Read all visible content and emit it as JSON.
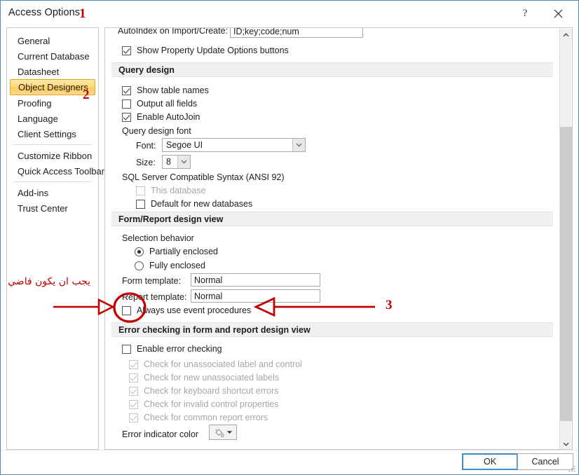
{
  "window": {
    "title": "Access Options",
    "help_icon": "?",
    "close_icon": "close-icon"
  },
  "sidebar": {
    "items": [
      {
        "label": "General",
        "selected": false
      },
      {
        "label": "Current Database",
        "selected": false
      },
      {
        "label": "Datasheet",
        "selected": false
      },
      {
        "label": "Object Designers",
        "selected": true
      },
      {
        "label": "Proofing",
        "selected": false
      },
      {
        "label": "Language",
        "selected": false
      },
      {
        "label": "Client Settings",
        "selected": false
      },
      {
        "label": "Customize Ribbon",
        "selected": false
      },
      {
        "label": "Quick Access Toolbar",
        "selected": false
      },
      {
        "label": "Add-ins",
        "selected": false
      },
      {
        "label": "Trust Center",
        "selected": false
      }
    ]
  },
  "content": {
    "table_design": {
      "autoindex_label": "AutoIndex on Import/Create:",
      "autoindex_value": "ID;key;code;num",
      "show_property_update": {
        "label": "Show Property Update Options buttons",
        "checked": true
      }
    },
    "query_design": {
      "header": "Query design",
      "show_table_names": {
        "label": "Show table names",
        "checked": true
      },
      "output_all_fields": {
        "label": "Output all fields",
        "checked": false
      },
      "enable_autojoin": {
        "label": "Enable AutoJoin",
        "checked": true
      },
      "font_group_label": "Query design font",
      "font_label": "Font:",
      "font_value": "Segoe UI",
      "size_label": "Size:",
      "size_value": "8",
      "sql_label": "SQL Server Compatible Syntax (ANSI 92)",
      "this_database": {
        "label": "This database",
        "checked": false,
        "disabled": true
      },
      "default_new_db": {
        "label": "Default for new databases",
        "checked": false,
        "disabled": false
      }
    },
    "form_report": {
      "header": "Form/Report design view",
      "selection_behavior_label": "Selection behavior",
      "partially_enclosed": {
        "label": "Partially enclosed",
        "selected": true
      },
      "fully_enclosed": {
        "label": "Fully enclosed",
        "selected": false
      },
      "form_template_label": "Form template:",
      "form_template_value": "Normal",
      "report_template_label": "Report template:",
      "report_template_value": "Normal",
      "always_event_procedures": {
        "label": "Always use event procedures",
        "checked": false
      }
    },
    "error_checking": {
      "header": "Error checking in form and report design view",
      "enable": {
        "label": "Enable error checking",
        "checked": false,
        "disabled": false
      },
      "items": [
        {
          "label": "Check for unassociated label and control",
          "checked": true,
          "disabled": true
        },
        {
          "label": "Check for new unassociated labels",
          "checked": true,
          "disabled": true
        },
        {
          "label": "Check for keyboard shortcut errors",
          "checked": true,
          "disabled": true
        },
        {
          "label": "Check for invalid control properties",
          "checked": true,
          "disabled": true
        },
        {
          "label": "Check for common report errors",
          "checked": true,
          "disabled": true
        }
      ],
      "indicator_label": "Error indicator color",
      "indicator_icon": "paint-bucket-icon"
    }
  },
  "footer": {
    "ok_label": "OK",
    "cancel_label": "Cancel"
  },
  "annotations": {
    "marker_1": "1",
    "marker_2": "2",
    "marker_3": "3",
    "arabic_note": "يجب ان يكون فاضي",
    "accent_color": "#c00000"
  }
}
